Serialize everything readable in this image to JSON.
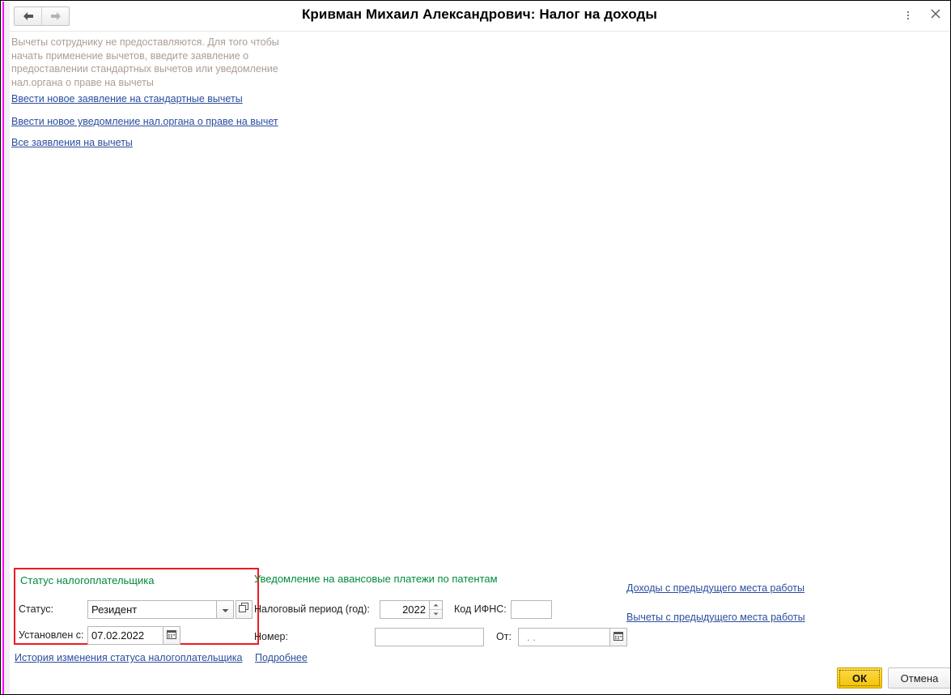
{
  "window": {
    "title": "Кривман Михаил Александрович: Налог на доходы",
    "nav_back": "back-arrow",
    "nav_forward": "forward-arrow",
    "menu_icon": "more-vertical-icon",
    "close_icon": "close-icon"
  },
  "hint": {
    "text": "Вычеты сотруднику не предоставляются. Для того чтобы начать применение вычетов, введите заявление о предоставлении стандартных вычетов или уведомление нал.органа о праве на вычеты"
  },
  "top_links": [
    {
      "label": "Ввести новое заявление на стандартные вычеты"
    },
    {
      "label": "Ввести новое уведомление нал.органа о праве на вычет"
    },
    {
      "label": "Все заявления на вычеты"
    }
  ],
  "status_panel": {
    "title": "Статус налогоплательщика",
    "status_label": "Статус:",
    "status_value": "Резидент",
    "status_dropdown_icon": "chevron-down-icon",
    "status_open_icon": "open-list-icon",
    "установлен_label": "Установлен с:",
    "date_value": "07.02.2022",
    "date_icon": "calendar-icon",
    "border_color": "#ee1b24",
    "title_color": "#008a3c"
  },
  "patent_panel": {
    "title": "Уведомление на авансовые платежи по патентам",
    "period_label": "Налоговый период (год):",
    "period_value": "2022",
    "ifns_label": "Код ИФНС:",
    "ifns_value": "",
    "number_label": "Номер:",
    "number_value": "",
    "from_label": "От:",
    "from_value": ". .",
    "from_icon": "calendar-icon",
    "spinner_up_icon": "spinner-up-icon",
    "spinner_down_icon": "spinner-down-icon"
  },
  "bottom_links": [
    {
      "label": "История изменения статуса налогоплательщика"
    },
    {
      "label": "Подробнее"
    }
  ],
  "side_links": [
    {
      "label": "Доходы с предыдущего места работы"
    },
    {
      "label": "Вычеты с предыдущего места работы"
    }
  ],
  "footer": {
    "ok_label": "ОК",
    "cancel_label": "Отмена"
  }
}
